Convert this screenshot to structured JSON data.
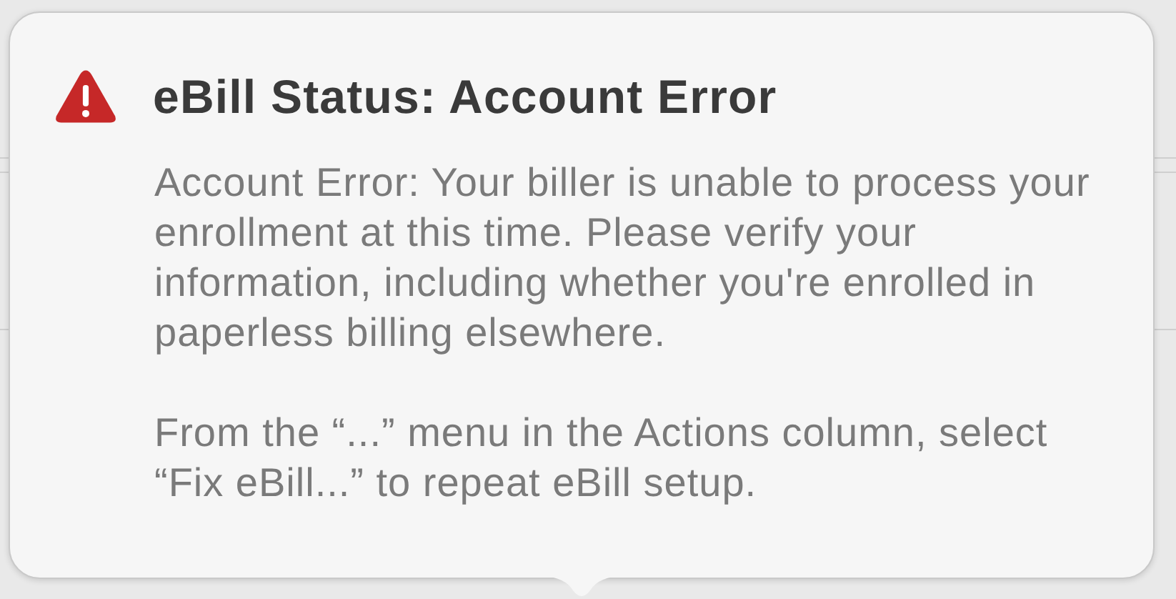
{
  "popover": {
    "title": "eBill Status: Account Error",
    "paragraphs": [
      "Account Error: Your biller is unable to process your enrollment at this time. Please verify your information, including whether you're enrolled in paperless billing elsewhere.",
      "From the “...” menu in the Actions column, select “Fix eBill...” to repeat eBill setup."
    ]
  }
}
